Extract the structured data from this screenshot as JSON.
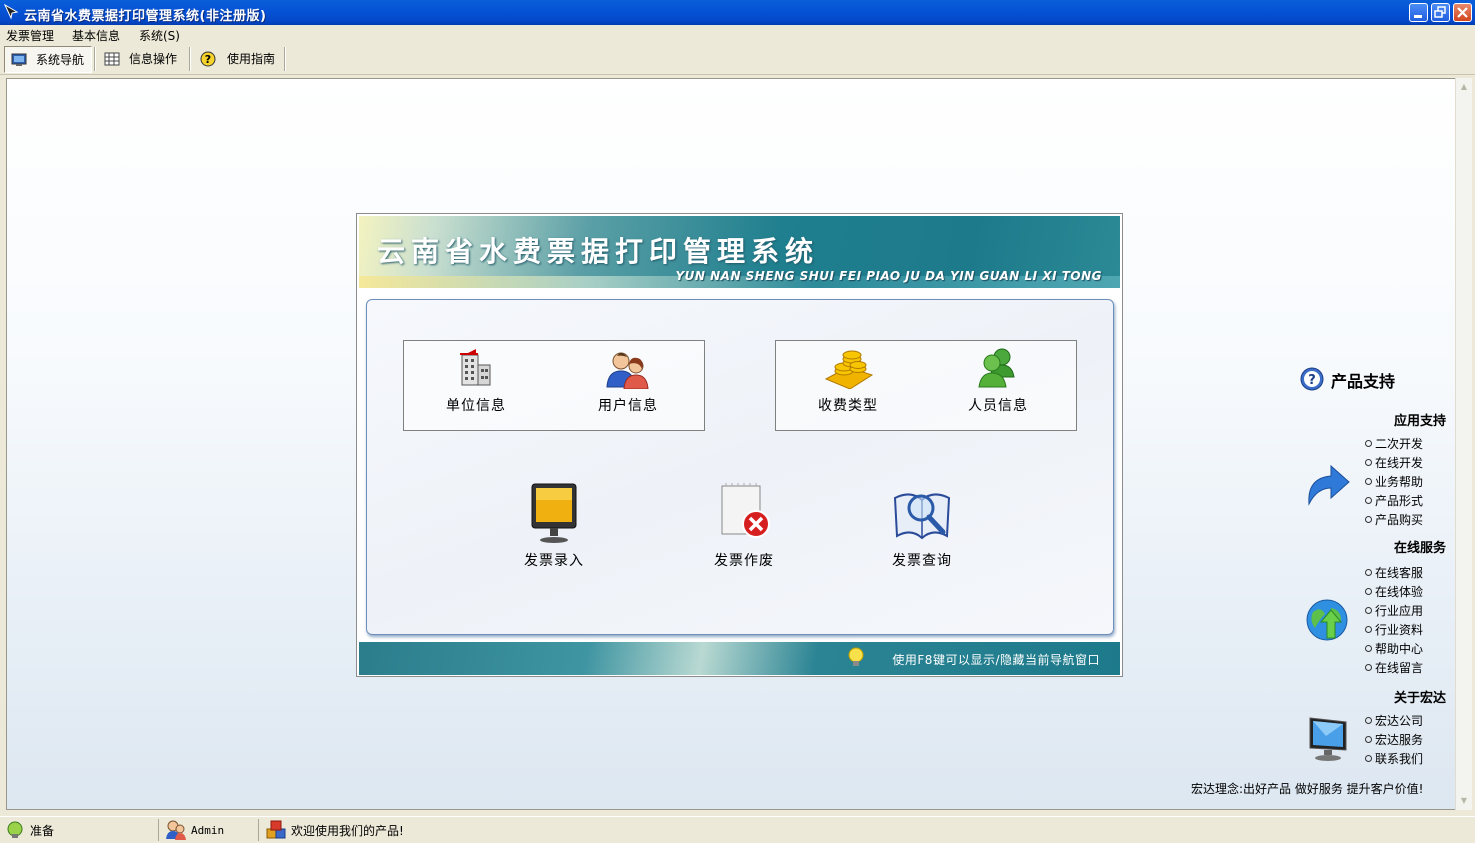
{
  "window": {
    "title": "云南省水费票据打印管理系统(非注册版)"
  },
  "menu": [
    "发票管理",
    "基本信息",
    "系统(S)"
  ],
  "toolbar": {
    "tabs": [
      {
        "label": "系统导航",
        "icon": "monitor-icon",
        "active": true
      },
      {
        "label": "信息操作",
        "icon": "grid-icon",
        "active": false
      },
      {
        "label": "使用指南",
        "icon": "help-icon",
        "active": false
      }
    ]
  },
  "panel": {
    "title_cn": "云南省水费票据打印管理系统",
    "title_pinyin": "YUN NAN SHENG SHUI FEI PIAO JU DA YIN GUAN LI XI TONG",
    "group1": [
      {
        "label": "单位信息",
        "icon": "building-icon"
      },
      {
        "label": "用户信息",
        "icon": "users-icon"
      }
    ],
    "group2": [
      {
        "label": "收费类型",
        "icon": "coins-icon"
      },
      {
        "label": "人员信息",
        "icon": "people-icon"
      }
    ],
    "actions": [
      {
        "label": "发票录入",
        "icon": "monitor-icon"
      },
      {
        "label": "发票作废",
        "icon": "cancel-invoice-icon"
      },
      {
        "label": "发票查询",
        "icon": "search-book-icon"
      }
    ],
    "footer_hint": "使用F8键可以显示/隐藏当前导航窗口"
  },
  "support": {
    "title": "产品支持",
    "sections": [
      {
        "heading": "应用支持",
        "links": [
          "二次开发",
          "在线开发",
          "业务帮助",
          "产品形式",
          "产品购买"
        ]
      },
      {
        "heading": "在线服务",
        "links": [
          "在线客服",
          "在线体验",
          "行业应用",
          "行业资料",
          "帮助中心",
          "在线留言"
        ]
      },
      {
        "heading": "关于宏达",
        "links": [
          "宏达公司",
          "宏达服务",
          "联系我们"
        ]
      }
    ],
    "motto": "宏达理念:出好产品 做好服务 提升客户价值!"
  },
  "statusbar": {
    "status": "准备",
    "user": "Admin",
    "welcome": "欢迎使用我们的产品!"
  },
  "colors": {
    "titlebar": "#0654d6",
    "banner": "#1f7f8e",
    "chrome": "#ece9d8"
  }
}
